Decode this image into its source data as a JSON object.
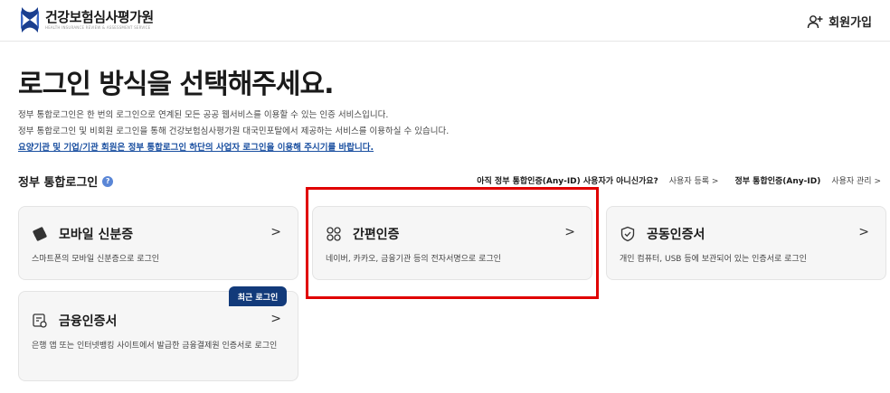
{
  "header": {
    "logo_name": "건강보험심사평가원",
    "logo_sub": "HEALTH INSURANCE REVIEW & ASSESSMENT SERVICE",
    "signup_label": "회원가입"
  },
  "main": {
    "title": "로그인 방식을 선택해주세요.",
    "desc_1": "정부 통합로그인은 한 번의 로그인으로 연계된 모든 공공 웹서비스를 이용할 수 있는 인증 서비스입니다.",
    "desc_2": "정부 통합로그인 및 비회원 로그인을 통해 건강보험심사평가원 대국민포탈에서 제공하는 서비스를 이용하실 수 있습니다.",
    "desc_3": "요양기관 및 기업/기관 회원은 정부 통합로그인 하단의 사업자 로그인을 이용해 주시기를 바랍니다."
  },
  "section": {
    "title": "정부 통합로그인",
    "help": "?",
    "question": "아직 정부 통합인증(Any-ID) 사용자가 아니신가요?",
    "register_link": "사용자 등록",
    "anyid_label": "정부 통합인증(Any-ID)",
    "manage_link": "사용자 관리"
  },
  "cards": [
    {
      "title": "모바일 신분증",
      "desc": "스마트폰의 모바일 신분증으로 로그인",
      "icon": "mobile-id-icon"
    },
    {
      "title": "간편인증",
      "desc": "네이버, 카카오, 금융기관 등의 전자서명으로 로그인",
      "icon": "simple-auth-icon"
    },
    {
      "title": "공동인증서",
      "desc": "개인 컴퓨터, USB 등에 보관되어 있는 인증서로 로그인",
      "icon": "shield-icon"
    },
    {
      "title": "금융인증서",
      "desc": "은행 앱 또는 인터넷뱅킹 사이트에서 발급한 금융결제원 인증서로 로그인",
      "icon": "financial-cert-icon"
    }
  ],
  "badge": {
    "label": "최근 로그인"
  },
  "arrow": ">",
  "colors": {
    "highlight": "#e00000",
    "link": "#1a4fa0",
    "badge": "#123a7a",
    "help": "#5a86d6"
  }
}
